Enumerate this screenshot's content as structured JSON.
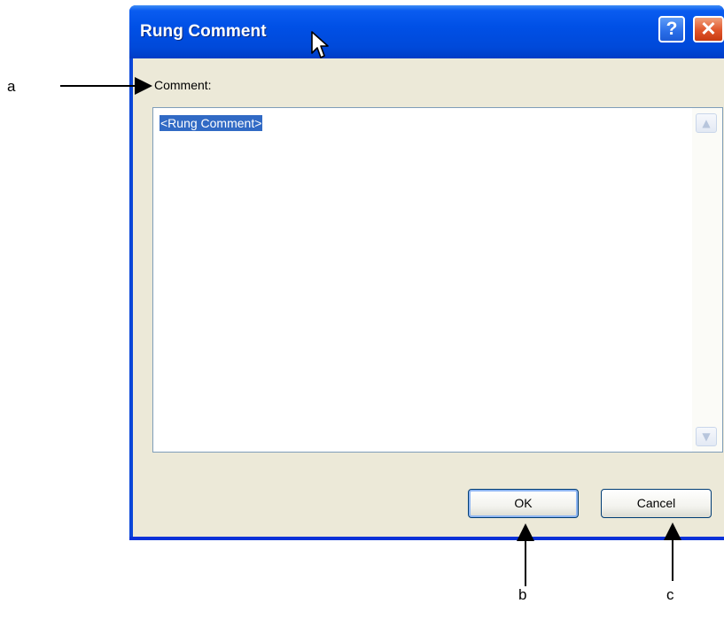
{
  "dialog": {
    "title": "Rung Comment",
    "help_button": "?",
    "close_button": "✕",
    "comment_label": "Comment:",
    "comment_value": "<Rung Comment>",
    "ok_label": "OK",
    "cancel_label": "Cancel"
  },
  "annotations": {
    "a": "a",
    "b": "b",
    "c": "c"
  },
  "colors": {
    "titlebar": "#0050e6",
    "dialog_bg": "#ece9d8",
    "selection": "#316ac5",
    "close_button": "#e0552a"
  }
}
